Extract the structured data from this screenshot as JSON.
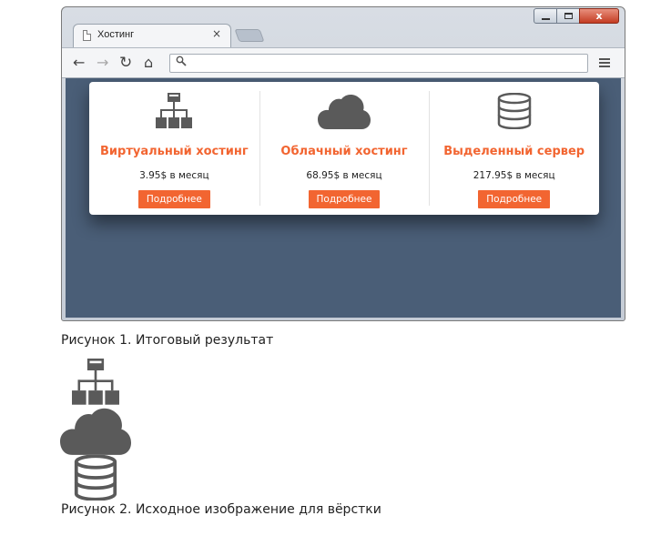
{
  "browser": {
    "tab_title": "Хостинг",
    "tab_close": "×",
    "address_value": "",
    "nav": {
      "back": "←",
      "forward": "→",
      "reload": "↻",
      "home": "⌂"
    },
    "window_controls": {
      "close": "x"
    }
  },
  "plans": [
    {
      "icon": "sitemap-icon",
      "title": "Виртуальный хостинг",
      "price": "3.95$ в месяц",
      "button": "Подробнее"
    },
    {
      "icon": "cloud-icon",
      "title": "Облачный хостинг",
      "price": "68.95$ в месяц",
      "button": "Подробнее"
    },
    {
      "icon": "database-icon",
      "title": "Выделенный сервер",
      "price": "217.95$ в месяц",
      "button": "Подробнее"
    }
  ],
  "captions": {
    "figure1": "Рисунок 1. Итоговый результат",
    "figure2": "Рисунок 2. Исходное изображение для вёрстки"
  },
  "colors": {
    "accent": "#f26531",
    "page_background": "#4a5e77",
    "icon": "#5a5a5a"
  }
}
